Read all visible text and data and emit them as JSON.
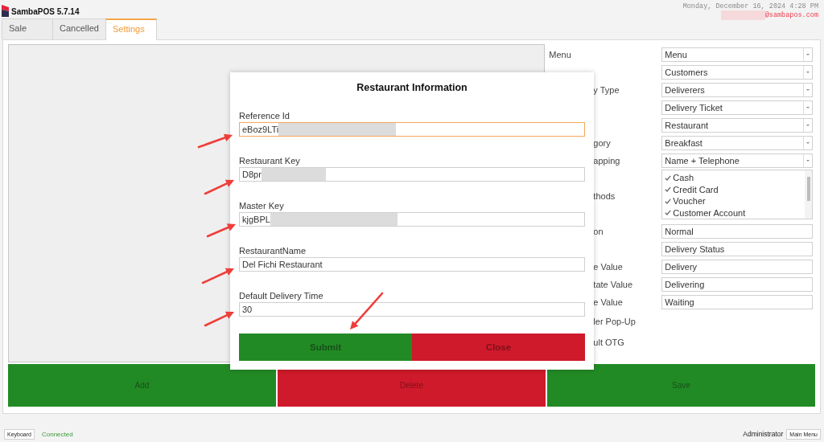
{
  "app": {
    "title": "SambaPOS 5.7.14",
    "datetime": "Monday, December 16, 2024 4:28 PM",
    "user_email": "@sambapos.com",
    "user_redacted": true
  },
  "tabs": [
    {
      "label": "Sale",
      "selected": false
    },
    {
      "label": "Cancelled",
      "selected": false
    },
    {
      "label": "Settings",
      "selected": true
    }
  ],
  "settings": {
    "rows": [
      {
        "label": "Menu",
        "kind": "dropdown",
        "value": "Menu"
      },
      {
        "kind": "dropdown",
        "value": "Customers"
      },
      {
        "label": "y Type",
        "kind": "dropdown",
        "value": "Deliverers"
      },
      {
        "kind": "dropdown",
        "value": "Delivery Ticket"
      },
      {
        "kind": "dropdown",
        "value": "Restaurant"
      },
      {
        "label": "gory",
        "kind": "dropdown",
        "value": "Breakfast"
      },
      {
        "label": "apping",
        "kind": "dropdown",
        "value": "Name + Telephone"
      },
      {
        "label": "thods",
        "kind": "checklist",
        "items": [
          {
            "label": "Cash",
            "checked": true
          },
          {
            "label": "Credit Card",
            "checked": true
          },
          {
            "label": "Voucher",
            "checked": true
          },
          {
            "label": "Customer Account",
            "checked": true
          }
        ]
      },
      {
        "label": "on",
        "kind": "text",
        "value": "Normal"
      },
      {
        "kind": "text",
        "value": "Delivery Status"
      },
      {
        "label": "e Value",
        "kind": "text",
        "value": "Delivery"
      },
      {
        "label": "tate Value",
        "kind": "text",
        "value": "Delivering"
      },
      {
        "label": "e Value",
        "kind": "text",
        "value": "Waiting"
      },
      {
        "label": "ler Pop-Up",
        "kind": "label"
      },
      {
        "label": "ult OTG",
        "kind": "label"
      }
    ]
  },
  "actions": [
    {
      "label": "Add",
      "kind": "confirm"
    },
    {
      "label": "Delete",
      "kind": "danger"
    },
    {
      "label": "Save",
      "kind": "confirm"
    }
  ],
  "dialog": {
    "title": "Restaurant Information",
    "fields": [
      {
        "label": "Reference Id",
        "value": "eBoz9LTi",
        "redacted": true,
        "focused": true
      },
      {
        "label": "Restaurant Key",
        "value": "D8pr",
        "redacted": true,
        "focused": false
      },
      {
        "label": "Master Key",
        "value": "kjgBPL",
        "redacted": true,
        "focused": false
      },
      {
        "label": "RestaurantName",
        "value": "Del Fichi Restaurant",
        "redacted": false,
        "focused": false
      },
      {
        "label": "Default Delivery Time",
        "value": "30",
        "redacted": false,
        "focused": false
      }
    ],
    "buttons": [
      {
        "label": "Submit",
        "kind": "confirm"
      },
      {
        "label": "Close",
        "kind": "danger"
      }
    ]
  },
  "status_bar": {
    "keyboard_button": "Keyboard",
    "connection": "Connected",
    "user": "Administrator",
    "main_menu_button": "Main Menu"
  }
}
